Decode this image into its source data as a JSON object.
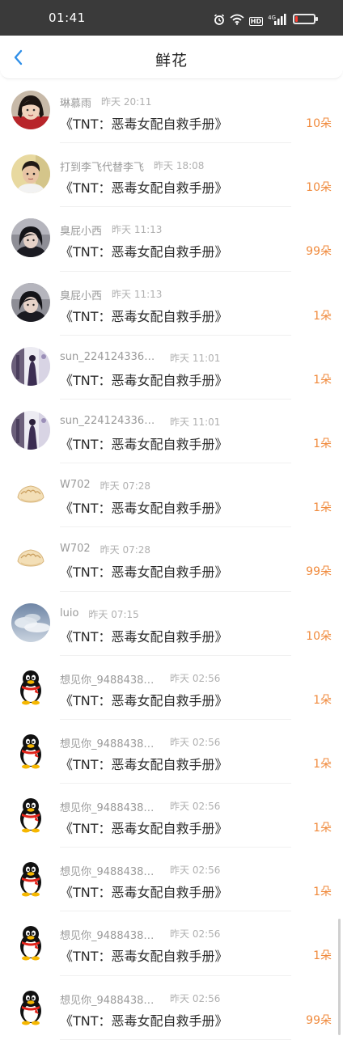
{
  "status_bar": {
    "time": "01:41",
    "battery_level": 0.12
  },
  "header": {
    "title": "鲜花",
    "back_icon": "chevron-left-icon"
  },
  "colors": {
    "accent_blue": "#2f8fe8",
    "amount_orange": "#f08a3c",
    "status_bar_bg": "#3a3a3a"
  },
  "items": [
    {
      "avatar": "photo-girl",
      "name": "琳慕雨",
      "time": "昨天 20:11",
      "book": "《TNT：恶毒女配自救手册》",
      "amount": "10朵"
    },
    {
      "avatar": "photo-boy",
      "name": "打到李飞代替李飞",
      "time": "昨天 18:08",
      "book": "《TNT：恶毒女配自救手册》",
      "amount": "10朵"
    },
    {
      "avatar": "photo-dark",
      "name": "臭屁小西",
      "time": "昨天 11:13",
      "book": "《TNT：恶毒女配自救手册》",
      "amount": "99朵"
    },
    {
      "avatar": "photo-dark",
      "name": "臭屁小西",
      "time": "昨天 11:13",
      "book": "《TNT：恶毒女配自救手册》",
      "amount": "1朵"
    },
    {
      "avatar": "photo-stage",
      "name": "sun_22412433610...",
      "time": "昨天 11:01",
      "book": "《TNT：恶毒女配自救手册》",
      "amount": "1朵"
    },
    {
      "avatar": "photo-stage",
      "name": "sun_22412433610...",
      "time": "昨天 11:01",
      "book": "《TNT：恶毒女配自救手册》",
      "amount": "1朵"
    },
    {
      "avatar": "dumpling",
      "name": "W702",
      "time": "昨天 07:28",
      "book": "《TNT：恶毒女配自救手册》",
      "amount": "1朵"
    },
    {
      "avatar": "dumpling",
      "name": "W702",
      "time": "昨天 07:28",
      "book": "《TNT：恶毒女配自救手册》",
      "amount": "99朵"
    },
    {
      "avatar": "sky",
      "name": "luio",
      "time": "昨天 07:15",
      "book": "《TNT：恶毒女配自救手册》",
      "amount": "10朵"
    },
    {
      "avatar": "penguin",
      "name": "想见你_94884382...",
      "time": "昨天 02:56",
      "book": "《TNT：恶毒女配自救手册》",
      "amount": "1朵"
    },
    {
      "avatar": "penguin",
      "name": "想见你_94884382...",
      "time": "昨天 02:56",
      "book": "《TNT：恶毒女配自救手册》",
      "amount": "1朵"
    },
    {
      "avatar": "penguin",
      "name": "想见你_94884382...",
      "time": "昨天 02:56",
      "book": "《TNT：恶毒女配自救手册》",
      "amount": "1朵"
    },
    {
      "avatar": "penguin",
      "name": "想见你_94884382...",
      "time": "昨天 02:56",
      "book": "《TNT：恶毒女配自救手册》",
      "amount": "1朵"
    },
    {
      "avatar": "penguin",
      "name": "想见你_94884382...",
      "time": "昨天 02:56",
      "book": "《TNT：恶毒女配自救手册》",
      "amount": "1朵"
    },
    {
      "avatar": "penguin",
      "name": "想见你_94884382...",
      "time": "昨天 02:56",
      "book": "《TNT：恶毒女配自救手册》",
      "amount": "99朵"
    }
  ]
}
